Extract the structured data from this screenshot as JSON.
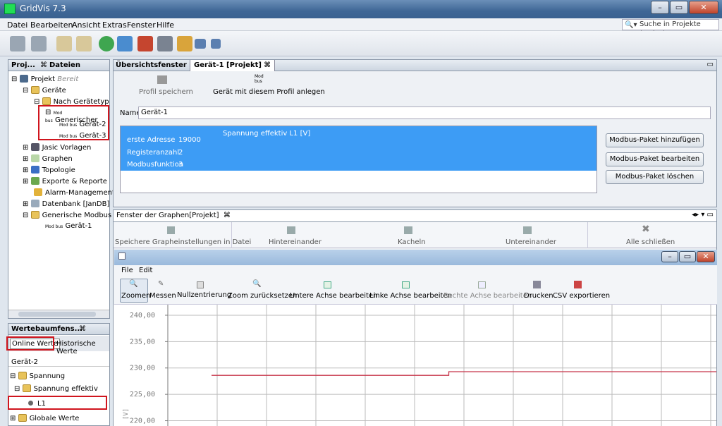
{
  "app": {
    "title": "GridVis 7.3"
  },
  "menu": [
    "Datei",
    "Bearbeiten",
    "Ansicht",
    "Extras",
    "Fenster",
    "Hilfe"
  ],
  "search": {
    "placeholder": "Suche in Projekte (Ctrl+I)"
  },
  "left_panel": {
    "tab1": "Proj...",
    "tab2": "Dateien",
    "tree": [
      "Projekt",
      "Bereit",
      "Geräte",
      "Nach Gerätetyp",
      "Generischer",
      "Gerät-2",
      "Gerät-3",
      "Jasic Vorlagen",
      "Graphen",
      "Topologie",
      "Exporte & Reporte",
      "Alarm-Management",
      "Datenbank [JanDB]",
      "Generische Modbus Geräte",
      "Gerät-1"
    ],
    "modbus_icon_label": "Modbus"
  },
  "values_panel": {
    "title": "Wertebaumfens...",
    "tab_online": "Online Werte",
    "tab_hist": "Historische Werte",
    "device": "Gerät-2",
    "items": [
      "Spannung",
      "Spannung effektiv",
      "L1",
      "Globale Werte"
    ]
  },
  "editor": {
    "tab1": "Übersichtsfenster",
    "tab2": "Gerät-1 [Projekt]",
    "save_profile": "Profil speichern",
    "create_device": "Gerät mit diesem Profil anlegen",
    "name_label": "Name",
    "name_value": "Gerät-1",
    "packet": {
      "title": "Spannung effektiv L1 [V]",
      "rows": [
        [
          "erste Adresse",
          "19000"
        ],
        [
          "Registeranzahl",
          "2"
        ],
        [
          "Modbusfunktion",
          "3"
        ]
      ]
    },
    "btn_add": "Modbus-Paket hinzufügen",
    "btn_edit": "Modbus-Paket bearbeiten",
    "btn_delete": "Modbus-Paket löschen"
  },
  "graph_window": {
    "tab": "Fenster der Graphen[Projekt]",
    "actions": [
      "Speichere Grapheinstellungen in Datei",
      "Hintereinander",
      "Kacheln",
      "Untereinander",
      "Alle schließen"
    ]
  },
  "graph": {
    "menu": [
      "File",
      "Edit"
    ],
    "tools": [
      "Zoomen",
      "Messen",
      "Nullzentrierung",
      "Zoom zurücksetzen",
      "Untere Achse bearbeiten",
      "Linke Achse bearbeiten",
      "Rechte Achse bearbeiten",
      "Drucken",
      "CSV exportieren"
    ],
    "yaxis_unit": "[V]"
  },
  "chart_data": {
    "type": "line",
    "ylim": [
      219,
      242
    ],
    "yticks": [
      "240,00",
      "235,00",
      "230,00",
      "225,00",
      "220,00"
    ],
    "yvalues": [
      240,
      235,
      230,
      225,
      220
    ],
    "series": [
      {
        "color": "#c8364a",
        "x": [
          0,
          0.47,
          0.47,
          1
        ],
        "y": [
          228.6,
          228.6,
          229.3,
          229.3
        ]
      }
    ]
  }
}
